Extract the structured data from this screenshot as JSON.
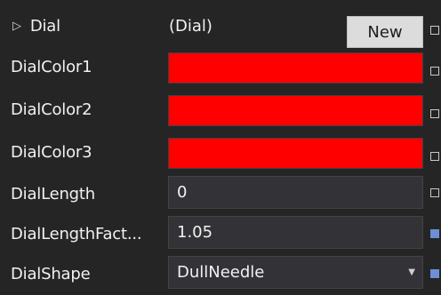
{
  "properties": {
    "dial": {
      "name": "Dial",
      "value": "(Dial)",
      "button_label": "New",
      "expander_glyph": "▷"
    },
    "dial_color1": {
      "name": "DialColor1",
      "color": "#ff0000"
    },
    "dial_color2": {
      "name": "DialColor2",
      "color": "#ff0000"
    },
    "dial_color3": {
      "name": "DialColor3",
      "color": "#ff0000"
    },
    "dial_length": {
      "name": "DialLength",
      "value": "0"
    },
    "dial_length_factor": {
      "name": "DialLengthFact...",
      "value": "1.05"
    },
    "dial_shape": {
      "name": "DialShape",
      "value": "DullNeedle",
      "arrow_glyph": "▼"
    }
  }
}
